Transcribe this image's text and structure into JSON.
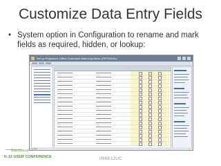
{
  "slide": {
    "title": "Customize Data Entry Fields",
    "bullet": "•",
    "bullet_text": "System option in Configuration to rename and mark fields as required, hidden, or lookup:",
    "hashtag": "#BBK12UC",
    "logo": {
      "brand": "Blackbaud",
      "conference": "K-12 USER CONFERENCE"
    }
  },
  "screenshot": {
    "window_title": "Set up Registrar's Office Customize data entry fields (OPTIONAL)",
    "status_text": "Ln Rel",
    "colors": {
      "title_bar": "#6b7f95",
      "highlight": "#fdf6c9",
      "selection": "#3d6fb3"
    }
  }
}
